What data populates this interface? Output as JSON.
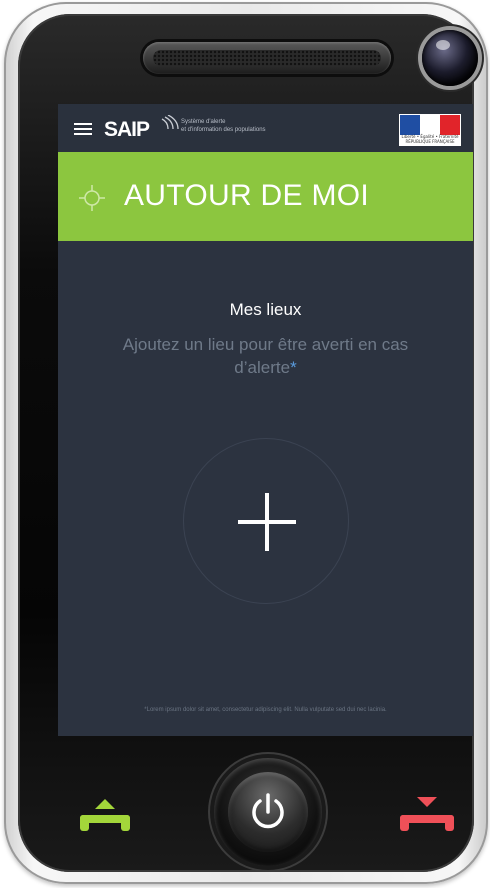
{
  "app": {
    "logo_text": "SAIP",
    "tagline_line1": "Système d'alerte",
    "tagline_line2": "et d'information des populations",
    "flag_caption": "Liberté • Égalité • Fraternité RÉPUBLIQUE FRANÇAISE"
  },
  "header": {
    "title": "AUTOUR DE MOI",
    "icon": "target-icon"
  },
  "places": {
    "title": "Mes lieux",
    "description": "Ajoutez un lieu pour être averti en cas d’alerte",
    "asterisk": "*",
    "add_icon": "plus-icon"
  },
  "footnote": "*Lorem ipsum dolor sit amet, consectetur adipiscing elit. Nulla vulputate sed dui nec lacinia.",
  "colors": {
    "accent": "#8cc63f",
    "screen_bg": "#2c3340",
    "answer": "#a3d63a",
    "hangup": "#ef5058"
  },
  "hardware": {
    "answer_icon": "answer-call-icon",
    "power_icon": "power-icon",
    "hangup_icon": "hang-up-icon"
  }
}
